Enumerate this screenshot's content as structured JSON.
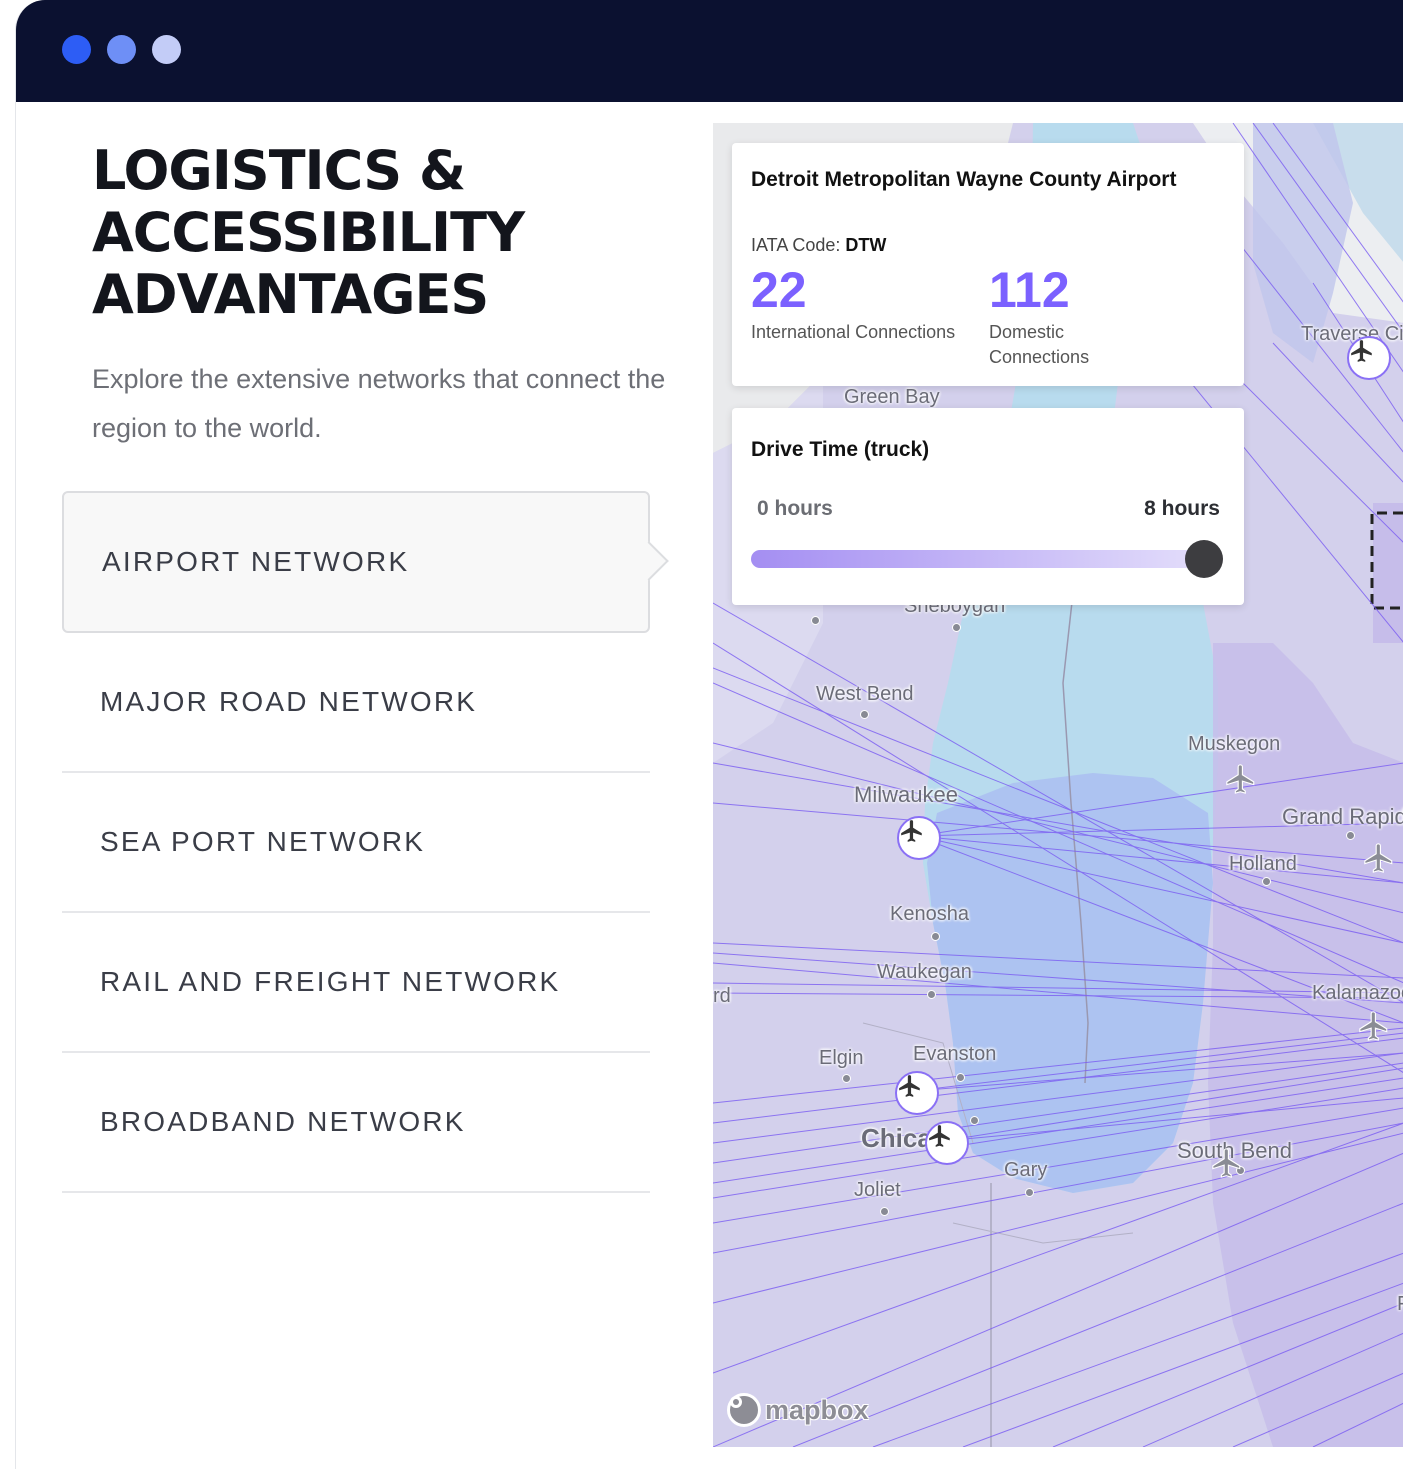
{
  "window": {
    "dot_colors": [
      "#2d5df5",
      "#6e8ff6",
      "#c3ccf7"
    ],
    "titlebar_color": "#0b1130"
  },
  "heading": {
    "line1": "LOGISTICS &",
    "line2": "ACCESSIBILITY",
    "line3": "ADVANTAGES"
  },
  "intro": "Explore the extensive networks that connect the region to the world.",
  "menu": {
    "active_index": 0,
    "items": [
      {
        "label": "AIRPORT NETWORK"
      },
      {
        "label": "MAJOR ROAD NETWORK"
      },
      {
        "label": "SEA PORT NETWORK"
      },
      {
        "label": "RAIL AND FREIGHT NETWORK"
      },
      {
        "label": "BROADBAND NETWORK"
      }
    ]
  },
  "airport_card": {
    "name": "Detroit Metropolitan Wayne County Airport",
    "iata_label": "IATA Code:",
    "iata_code": "DTW",
    "international_count": "22",
    "international_label": "International Connections",
    "domestic_count": "112",
    "domestic_label_1": "Domestic",
    "domestic_label_2": "Connections"
  },
  "drive_time": {
    "title": "Drive Time (truck)",
    "min_label": "0 hours",
    "max_label": "8 hours",
    "value_fraction": 1.0
  },
  "map": {
    "accent_color": "#7b61ff",
    "cities": [
      "Green Bay",
      "Sheboygan",
      "West Bend",
      "Milwaukee",
      "Kenosha",
      "Waukegan",
      "Elgin",
      "Evanston",
      "Chicago",
      "Joliet",
      "Gary",
      "Muskegon",
      "Grand Rapids",
      "Holland",
      "Kalamazoo",
      "South Bend",
      "Traverse City",
      "rd",
      "F"
    ],
    "attribution": "mapbox"
  }
}
